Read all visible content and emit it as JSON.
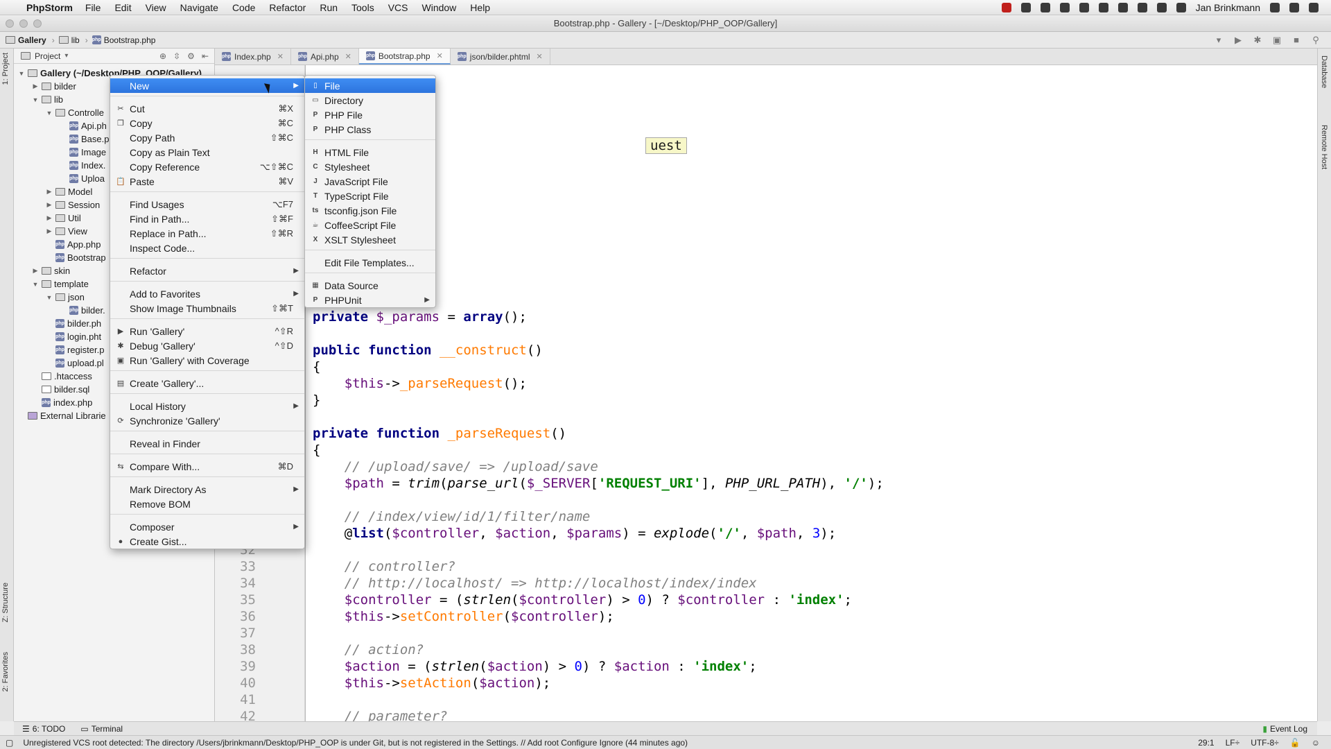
{
  "menubar": {
    "app_name": "PhpStorm",
    "items": [
      "File",
      "Edit",
      "View",
      "Navigate",
      "Code",
      "Refactor",
      "Run",
      "Tools",
      "VCS",
      "Window",
      "Help"
    ],
    "user": "Jan Brinkmann"
  },
  "window": {
    "title": "Bootstrap.php - Gallery - [~/Desktop/PHP_OOP/Gallery]"
  },
  "breadcrumb": [
    "Gallery",
    "lib",
    "Bootstrap.php"
  ],
  "project_panel": {
    "header": "Project",
    "vertical_tabs": {
      "project": "1: Project",
      "structure": "Z: Structure",
      "favorites": "2: Favorites"
    },
    "tree": [
      {
        "label": "Gallery (~/Desktop/PHP_OOP/Gallery)",
        "type": "folder",
        "arrow": "▼"
      },
      {
        "label": "bilder",
        "type": "folder",
        "arrow": "▶"
      },
      {
        "label": "lib",
        "type": "folder",
        "arrow": "▼"
      },
      {
        "label": "Controlle",
        "type": "folder",
        "arrow": "▼"
      },
      {
        "label": "Api.ph",
        "type": "php",
        "arrow": ""
      },
      {
        "label": "Base.p",
        "type": "php",
        "arrow": ""
      },
      {
        "label": "Image",
        "type": "php",
        "arrow": ""
      },
      {
        "label": "Index.",
        "type": "php",
        "arrow": ""
      },
      {
        "label": "Uploa",
        "type": "php",
        "arrow": ""
      },
      {
        "label": "Model",
        "type": "folder",
        "arrow": "▶"
      },
      {
        "label": "Session",
        "type": "folder",
        "arrow": "▶"
      },
      {
        "label": "Util",
        "type": "folder",
        "arrow": "▶"
      },
      {
        "label": "View",
        "type": "folder",
        "arrow": "▶"
      },
      {
        "label": "App.php",
        "type": "php",
        "arrow": ""
      },
      {
        "label": "Bootstrap",
        "type": "php",
        "arrow": ""
      },
      {
        "label": "skin",
        "type": "folder",
        "arrow": "▶"
      },
      {
        "label": "template",
        "type": "folder",
        "arrow": "▼"
      },
      {
        "label": "json",
        "type": "folder",
        "arrow": "▼"
      },
      {
        "label": "bilder.",
        "type": "php",
        "arrow": ""
      },
      {
        "label": "bilder.ph",
        "type": "php",
        "arrow": ""
      },
      {
        "label": "login.pht",
        "type": "php",
        "arrow": ""
      },
      {
        "label": "register.p",
        "type": "php",
        "arrow": ""
      },
      {
        "label": "upload.pl",
        "type": "php",
        "arrow": ""
      },
      {
        "label": ".htaccess",
        "type": "file",
        "arrow": ""
      },
      {
        "label": "bilder.sql",
        "type": "file",
        "arrow": ""
      },
      {
        "label": "index.php",
        "type": "php",
        "arrow": ""
      },
      {
        "label": "External Librarie",
        "type": "lib",
        "arrow": ""
      }
    ]
  },
  "tabs": [
    {
      "label": "Index.php",
      "active": false
    },
    {
      "label": "Api.php",
      "active": false
    },
    {
      "label": "Bootstrap.php",
      "active": true
    },
    {
      "label": "json/bilder.phtml",
      "active": false
    }
  ],
  "right_strip": {
    "database": "Database",
    "remote_host": "Remote Host"
  },
  "editor": {
    "highlight_fragment": "uest",
    "line_numbers": [
      "32",
      "33",
      "34",
      "35",
      "36",
      "37",
      "38",
      "39",
      "40",
      "41",
      "42"
    ]
  },
  "context_menu": {
    "items": [
      {
        "label": "New",
        "shortcut": "",
        "submenu": true,
        "selected": true,
        "icon": ""
      },
      {
        "label": "Cut",
        "shortcut": "⌘X",
        "icon": "scissors-icon",
        "glyph": "✂"
      },
      {
        "label": "Copy",
        "shortcut": "⌘C",
        "icon": "copy-icon",
        "glyph": "❐"
      },
      {
        "label": "Copy Path",
        "shortcut": "⇧⌘C"
      },
      {
        "label": "Copy as Plain Text",
        "shortcut": ""
      },
      {
        "label": "Copy Reference",
        "shortcut": "⌥⇧⌘C"
      },
      {
        "label": "Paste",
        "shortcut": "⌘V",
        "icon": "paste-icon",
        "glyph": "📋"
      },
      {
        "label": "Find Usages",
        "shortcut": "⌥F7"
      },
      {
        "label": "Find in Path...",
        "shortcut": "⇧⌘F"
      },
      {
        "label": "Replace in Path...",
        "shortcut": "⇧⌘R"
      },
      {
        "label": "Inspect Code...",
        "shortcut": ""
      },
      {
        "label": "Refactor",
        "shortcut": "",
        "submenu": true
      },
      {
        "label": "Add to Favorites",
        "shortcut": "",
        "submenu": true
      },
      {
        "label": "Show Image Thumbnails",
        "shortcut": "⇧⌘T"
      },
      {
        "label": "Run 'Gallery'",
        "shortcut": "^⇧R",
        "icon": "run-icon",
        "glyph": "▶"
      },
      {
        "label": "Debug 'Gallery'",
        "shortcut": "^⇧D",
        "icon": "debug-icon",
        "glyph": "✱"
      },
      {
        "label": "Run 'Gallery' with Coverage",
        "shortcut": "",
        "icon": "coverage-icon",
        "glyph": "▣"
      },
      {
        "label": "Create 'Gallery'...",
        "shortcut": "",
        "icon": "create-config-icon",
        "glyph": "▤"
      },
      {
        "label": "Local History",
        "shortcut": "",
        "submenu": true
      },
      {
        "label": "Synchronize 'Gallery'",
        "shortcut": "",
        "icon": "sync-icon",
        "glyph": "⟳"
      },
      {
        "label": "Reveal in Finder",
        "shortcut": ""
      },
      {
        "label": "Compare With...",
        "shortcut": "⌘D",
        "icon": "compare-icon",
        "glyph": "⇆"
      },
      {
        "label": "Mark Directory As",
        "shortcut": "",
        "submenu": true
      },
      {
        "label": "Remove BOM",
        "shortcut": ""
      },
      {
        "label": "Composer",
        "shortcut": "",
        "submenu": true
      },
      {
        "label": "Create Gist...",
        "shortcut": "",
        "icon": "github-icon",
        "glyph": "●"
      }
    ]
  },
  "new_submenu": {
    "items": [
      {
        "label": "File",
        "selected": true,
        "icon": "file-icon",
        "glyph": "▯"
      },
      {
        "label": "Directory",
        "icon": "folder-icon",
        "glyph": "▭"
      },
      {
        "label": "PHP File",
        "icon": "php-file-icon",
        "glyph": "P"
      },
      {
        "label": "PHP Class",
        "icon": "php-class-icon",
        "glyph": "P"
      },
      {
        "label": "HTML File",
        "icon": "html-file-icon",
        "glyph": "H"
      },
      {
        "label": "Stylesheet",
        "icon": "css-file-icon",
        "glyph": "C"
      },
      {
        "label": "JavaScript File",
        "icon": "js-file-icon",
        "glyph": "J"
      },
      {
        "label": "TypeScript File",
        "icon": "ts-file-icon",
        "glyph": "T"
      },
      {
        "label": "tsconfig.json File",
        "icon": "json-file-icon",
        "glyph": "ts"
      },
      {
        "label": "CoffeeScript File",
        "icon": "coffee-file-icon",
        "glyph": "☕"
      },
      {
        "label": "XSLT Stylesheet",
        "icon": "xslt-file-icon",
        "glyph": "X"
      },
      {
        "label": "Edit File Templates...",
        "icon": "",
        "glyph": ""
      },
      {
        "label": "Data Source",
        "icon": "datasource-icon",
        "glyph": "▦"
      },
      {
        "label": "PHPUnit",
        "icon": "phpunit-icon",
        "glyph": "P",
        "submenu": true
      }
    ]
  },
  "tool_tabs": {
    "todo": "6: TODO",
    "terminal": "Terminal",
    "event_log": "Event Log"
  },
  "statusbar": {
    "message": "Unregistered VCS root detected: The directory /Users/jbrinkmann/Desktop/PHP_OOP is under Git, but is not registered in the Settings. // Add root  Configure  Ignore (44 minutes ago)",
    "position": "29:1",
    "line_sep": "LF÷",
    "encoding": "UTF-8÷"
  },
  "colors": {
    "selection": "#3f8df2",
    "keyword": "#000080",
    "method": "#ff7a00",
    "variable": "#660e7a",
    "comment": "#808080",
    "string": "#008000"
  }
}
